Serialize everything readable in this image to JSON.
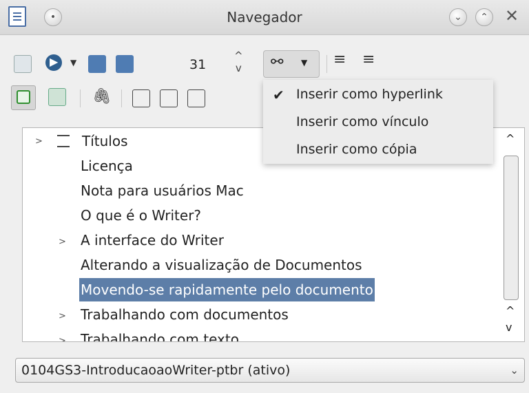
{
  "window": {
    "title": "Navegador"
  },
  "toolbar": {
    "spin_value": "31"
  },
  "insert_menu": {
    "items": [
      {
        "label": "Inserir como hyperlink",
        "checked": true
      },
      {
        "label": "Inserir como vínculo",
        "checked": false
      },
      {
        "label": "Inserir como cópia",
        "checked": false
      }
    ]
  },
  "tree": {
    "items": [
      {
        "label": "Títulos"
      },
      {
        "label": "Licença"
      },
      {
        "label": "Nota para usuários Mac"
      },
      {
        "label": "O que é o Writer?"
      },
      {
        "label": "A interface do Writer"
      },
      {
        "label": "Alterando a visualização de Documentos"
      },
      {
        "label": "Movendo-se rapidamente pelo documento",
        "selected": true
      },
      {
        "label": "Trabalhando com documentos"
      },
      {
        "label": "Trabalhando com texto"
      }
    ]
  },
  "document_selector": {
    "value": "0104GS3-IntroducaoaoWriter-ptbr (ativo)"
  },
  "colors": {
    "selection": "#5d7ea8",
    "accent": "#4a6ea5"
  }
}
